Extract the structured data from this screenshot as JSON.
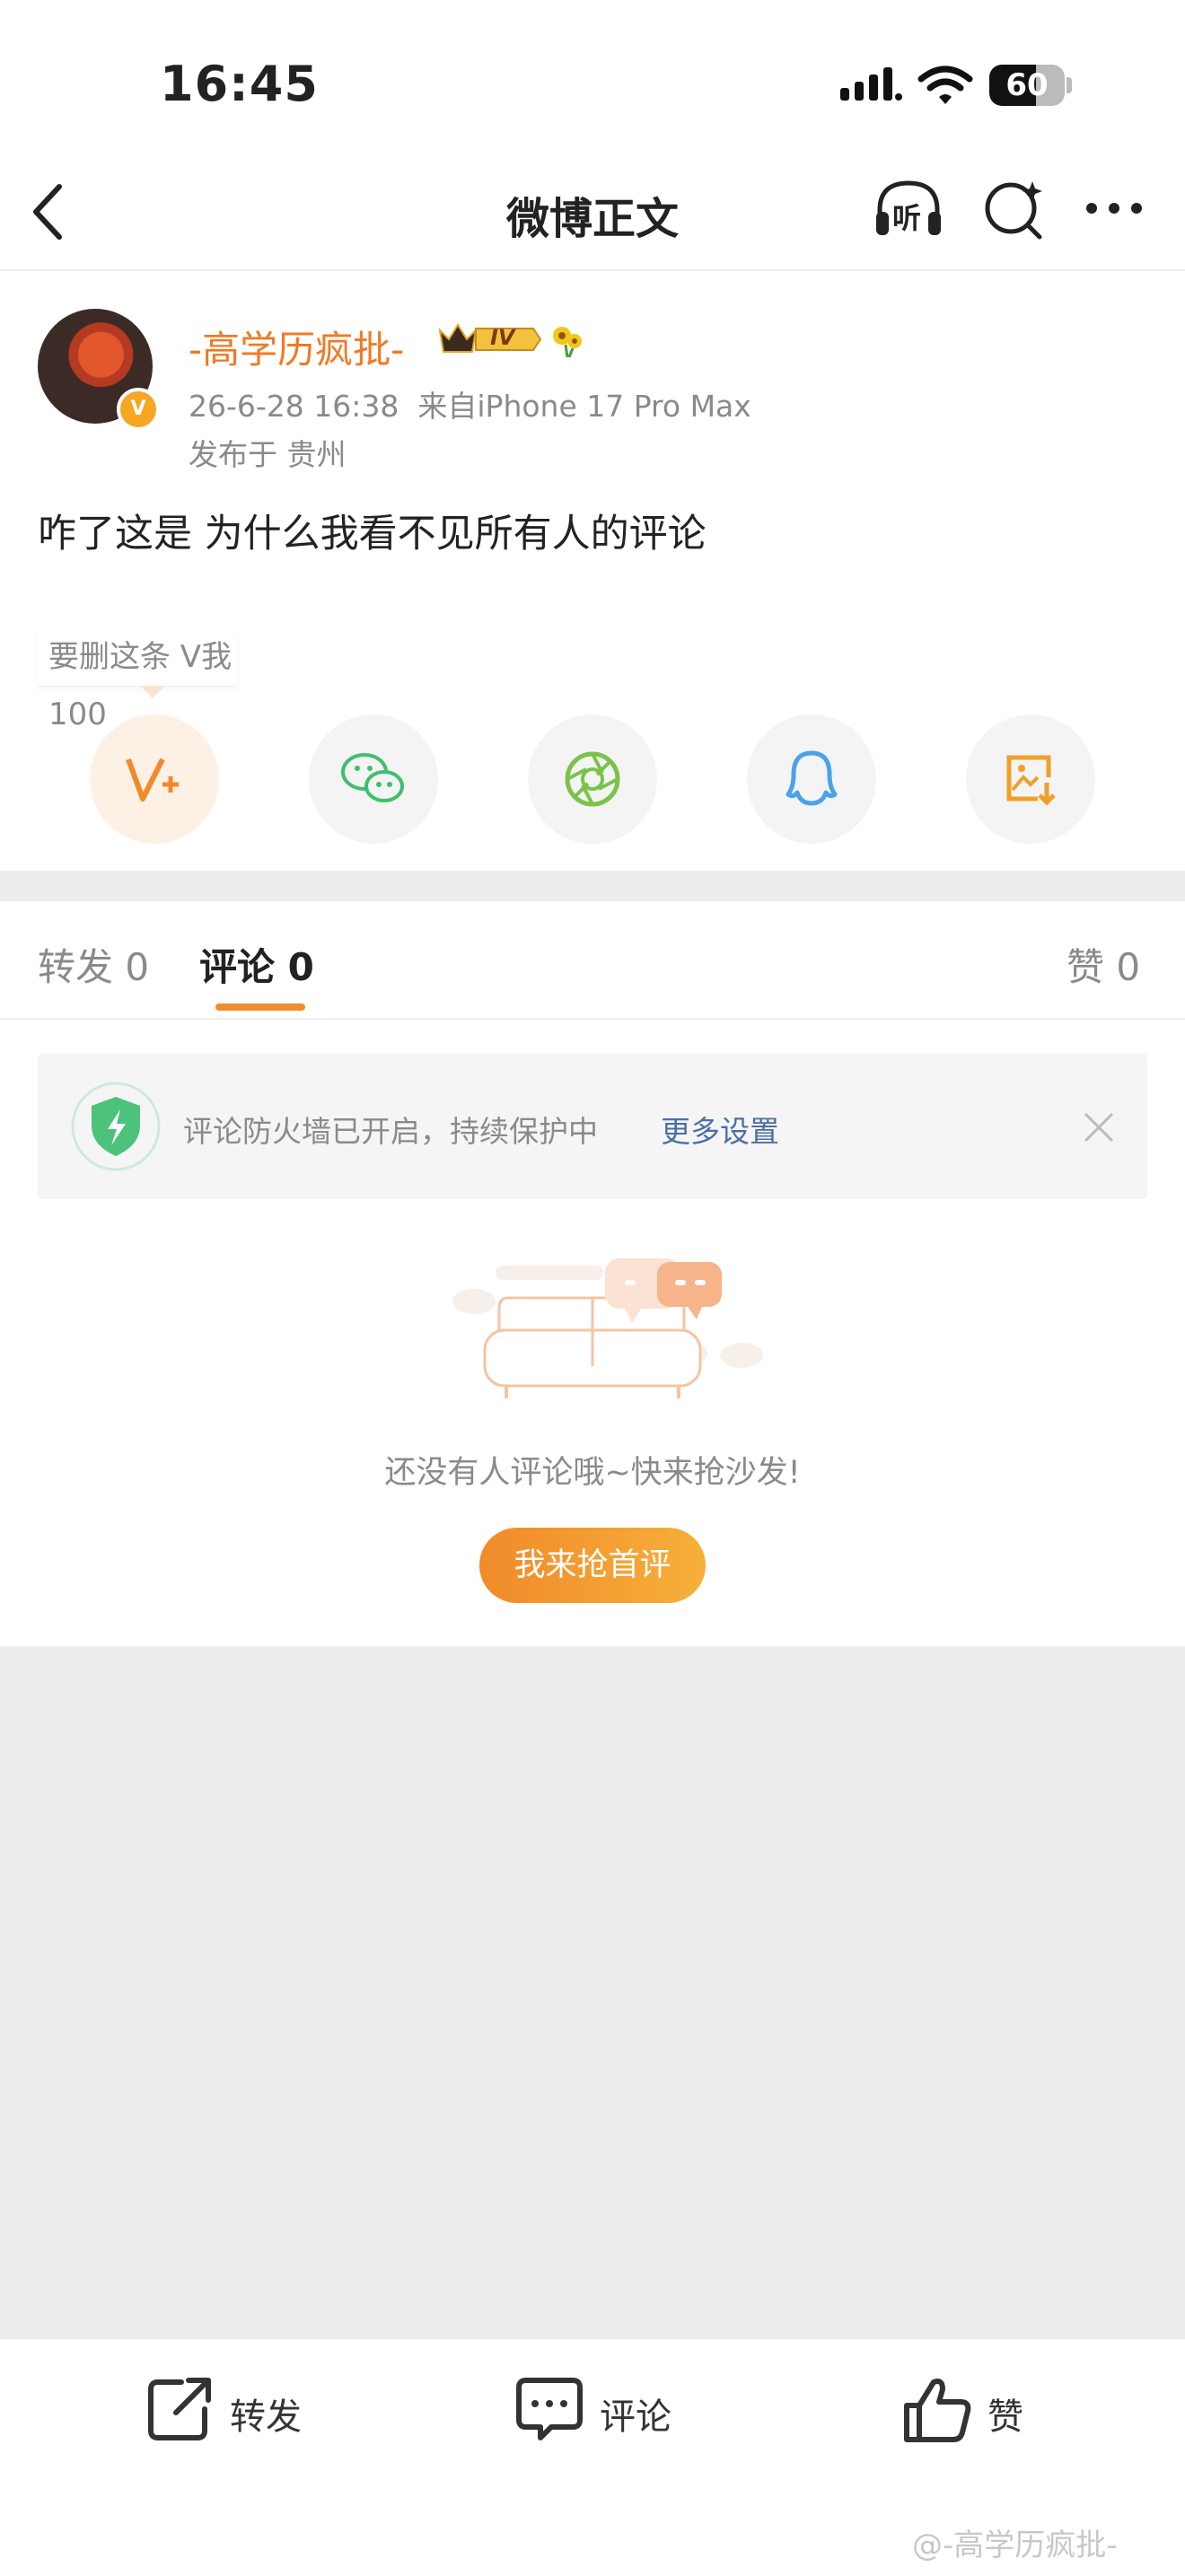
{
  "status_bar": {
    "time": "16:45",
    "battery": "60"
  },
  "nav": {
    "title": "微博正文",
    "listen_label": "听"
  },
  "post": {
    "username": "-高学历疯批-",
    "level_badge": "IV",
    "verified_mark": "V",
    "timestamp": "26-6-28 16:38",
    "source": "来自iPhone 17 Pro Max",
    "location": "发布于 贵州",
    "content": "咋了这是 为什么我看不见所有人的评论"
  },
  "share": {
    "tip": "要删这条 V我100",
    "buttons": [
      "v-plus-icon",
      "wechat-icon",
      "moments-icon",
      "qq-icon",
      "save-image-icon"
    ]
  },
  "tabs": {
    "repost": "转发 0",
    "comment_label": "评论",
    "comment_count": "0",
    "like": "赞 0"
  },
  "firewall": {
    "text": "评论防火墙已开启，持续保护中",
    "link": "更多设置"
  },
  "empty": {
    "text": "还没有人评论哦~快来抢沙发!",
    "button": "我来抢首评"
  },
  "bottom_bar": {
    "repost": "转发",
    "comment": "评论",
    "like": "赞"
  },
  "watermark": "@-高学历疯批-",
  "colors": {
    "accent": "#f08a2a",
    "username": "#f07a24",
    "link": "#4a6fa5",
    "background": "#ededed"
  }
}
